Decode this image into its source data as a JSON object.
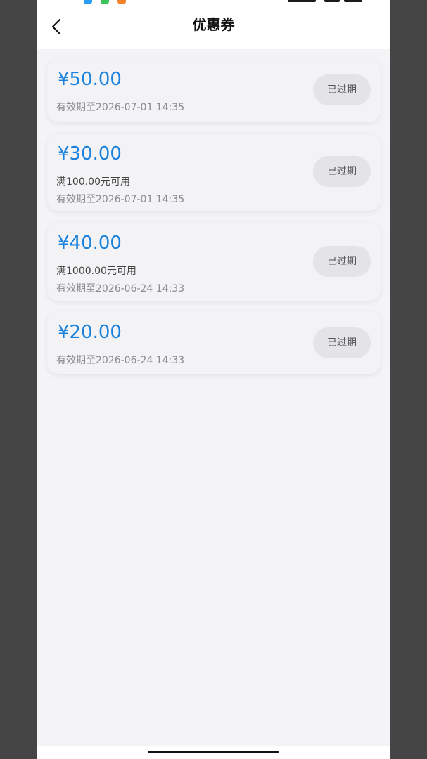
{
  "header": {
    "title": "优惠券",
    "back_icon": "chevron-left-icon"
  },
  "colors": {
    "accent": "#1a82dd",
    "page_bg": "#f4f4f6",
    "button_bg": "#e4e4e8"
  },
  "coupons": [
    {
      "amount": "¥50.00",
      "condition": "",
      "expiry": "有效期至2026-07-01 14:35",
      "status": "已过期"
    },
    {
      "amount": "¥30.00",
      "condition": "满100.00元可用",
      "expiry": "有效期至2026-07-01 14:35",
      "status": "已过期"
    },
    {
      "amount": "¥40.00",
      "condition": "满1000.00元可用",
      "expiry": "有效期至2026-06-24 14:33",
      "status": "已过期"
    },
    {
      "amount": "¥20.00",
      "condition": "",
      "expiry": "有效期至2026-06-24 14:33",
      "status": "已过期"
    }
  ]
}
